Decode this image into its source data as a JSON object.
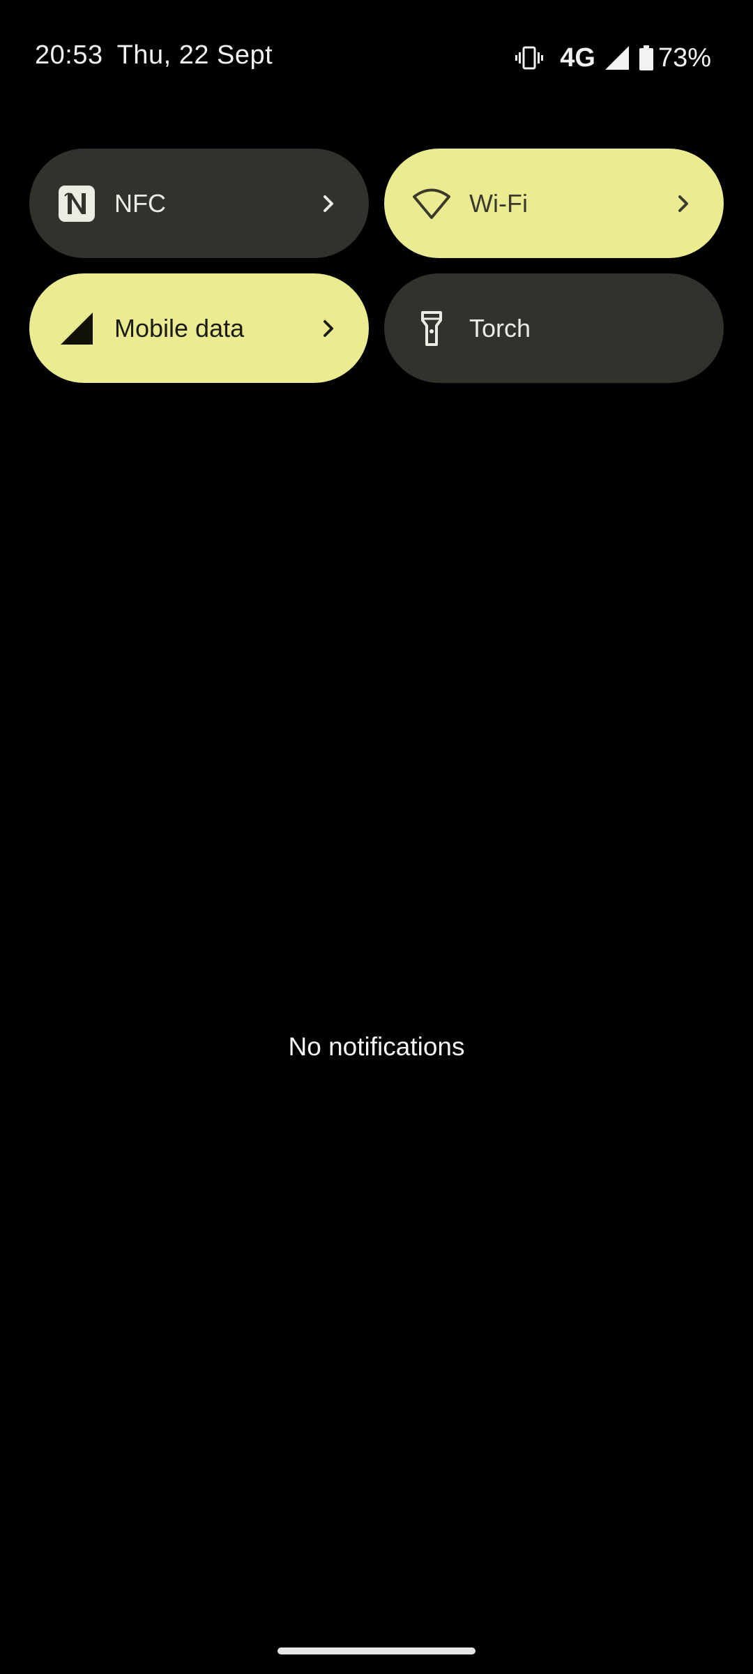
{
  "status_bar": {
    "time": "20:53",
    "date": "Thu, 22 Sept",
    "network": "4G",
    "battery": "73%",
    "icons": [
      "vibrate-icon",
      "signal-icon",
      "battery-icon"
    ]
  },
  "quick_settings": {
    "tiles": [
      {
        "label": "NFC",
        "state": "off",
        "icon": "nfc-icon",
        "has_chevron": true
      },
      {
        "label": "Wi-Fi",
        "state": "on",
        "icon": "wifi-icon",
        "has_chevron": true
      },
      {
        "label": "Mobile data",
        "state": "on",
        "icon": "mobile-data-icon",
        "has_chevron": true
      },
      {
        "label": "Torch",
        "state": "off",
        "icon": "torch-icon",
        "has_chevron": false
      }
    ]
  },
  "notifications": {
    "empty_text": "No notifications"
  },
  "colors": {
    "background": "#000000",
    "tile_on": "#ebec92",
    "tile_off": "#31322c"
  }
}
